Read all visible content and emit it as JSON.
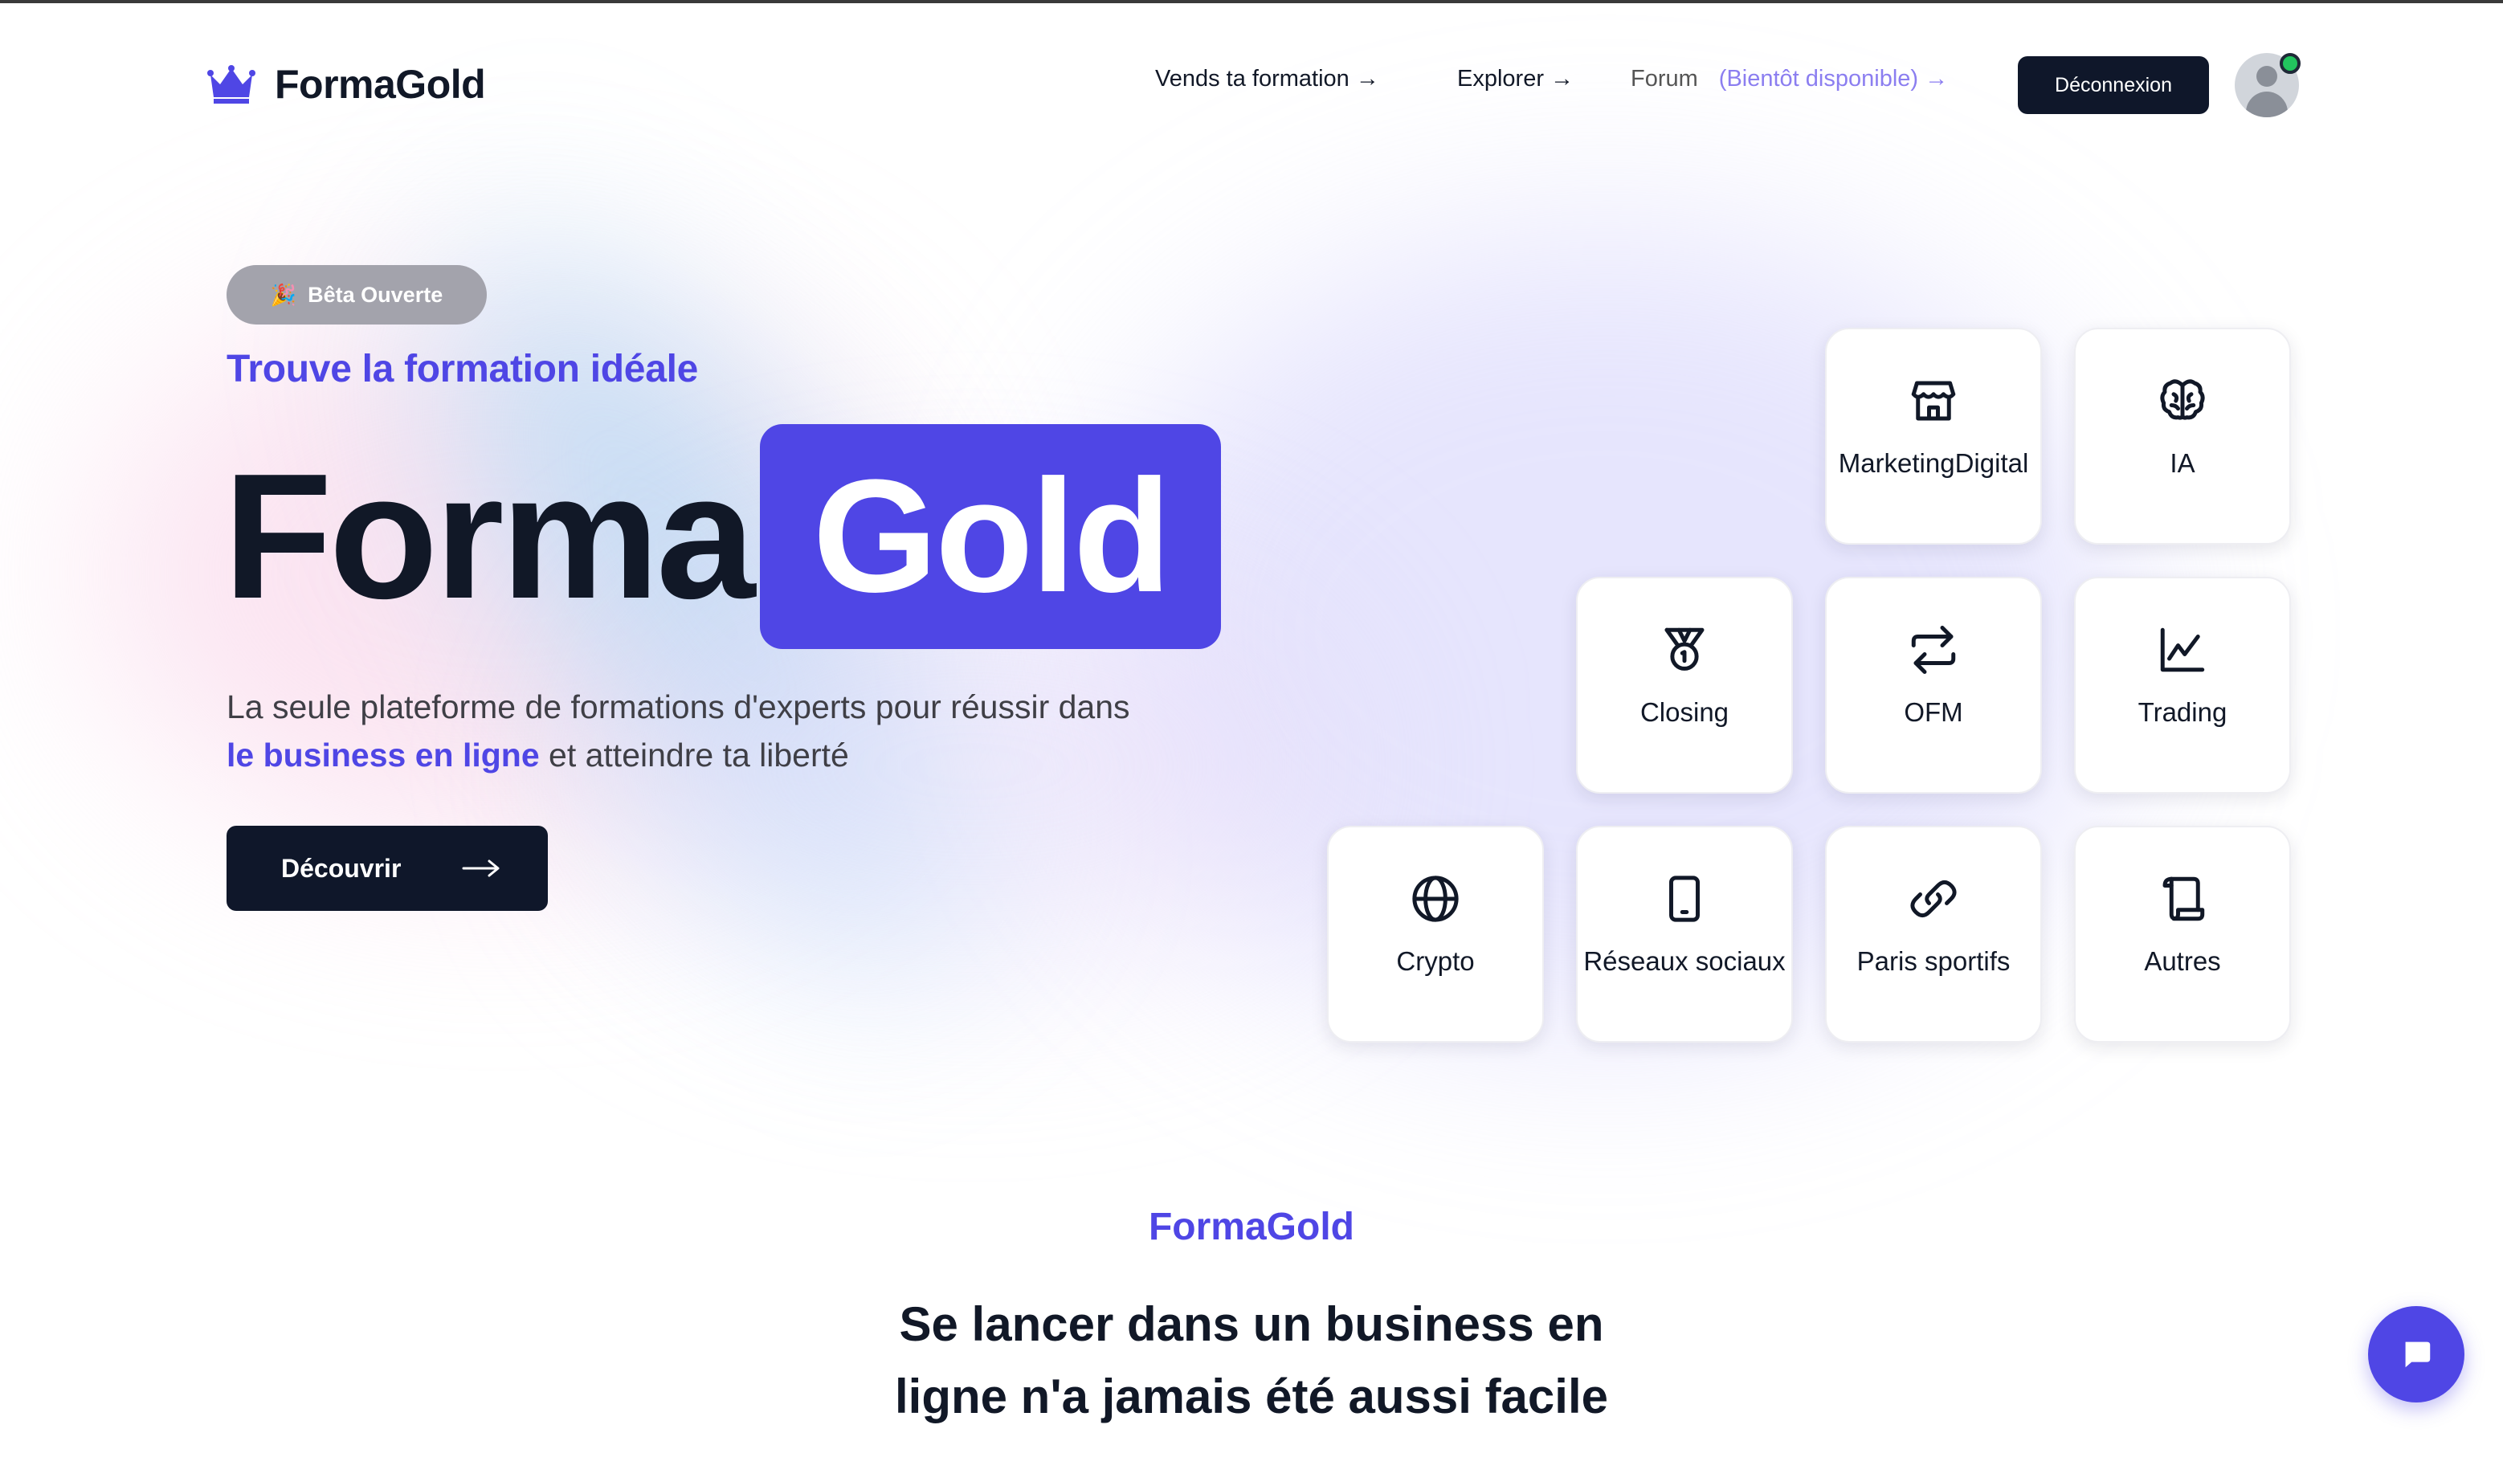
{
  "header": {
    "brand": "FormaGold",
    "nav": {
      "sell": "Vends ta formation →",
      "explore": "Explorer →",
      "forum": "Forum",
      "forum_soon": "(Bientôt disponible) →"
    },
    "logout": "Déconnexion"
  },
  "hero": {
    "badge": "Bêta Ouverte",
    "tagline": "Trouve la formation idéale",
    "title_part1": "Forma",
    "title_part2": "Gold",
    "desc_before": "La seule plateforme de formations d'experts pour réussir dans",
    "desc_highlight": "le business en ligne",
    "desc_after": "et atteindre ta liberté",
    "cta": "Découvrir"
  },
  "categories": [
    {
      "label": "MarketingDigital",
      "icon": "store-icon"
    },
    {
      "label": "IA",
      "icon": "brain-icon"
    },
    {
      "label": "Closing",
      "icon": "medal-icon"
    },
    {
      "label": "OFM",
      "icon": "repeat-icon"
    },
    {
      "label": "Trading",
      "icon": "line-chart-icon"
    },
    {
      "label": "Crypto",
      "icon": "globe-icon"
    },
    {
      "label": "Réseaux sociaux",
      "icon": "tablet-icon"
    },
    {
      "label": "Paris sportifs",
      "icon": "link-icon"
    },
    {
      "label": "Autres",
      "icon": "scroll-icon"
    }
  ],
  "section": {
    "brand": "FormaGold",
    "title": "Se lancer dans un business en ligne n'a jamais été aussi facile"
  },
  "colors": {
    "accent": "#4f46e5",
    "dark": "#0f172a",
    "online": "#22c55e"
  }
}
